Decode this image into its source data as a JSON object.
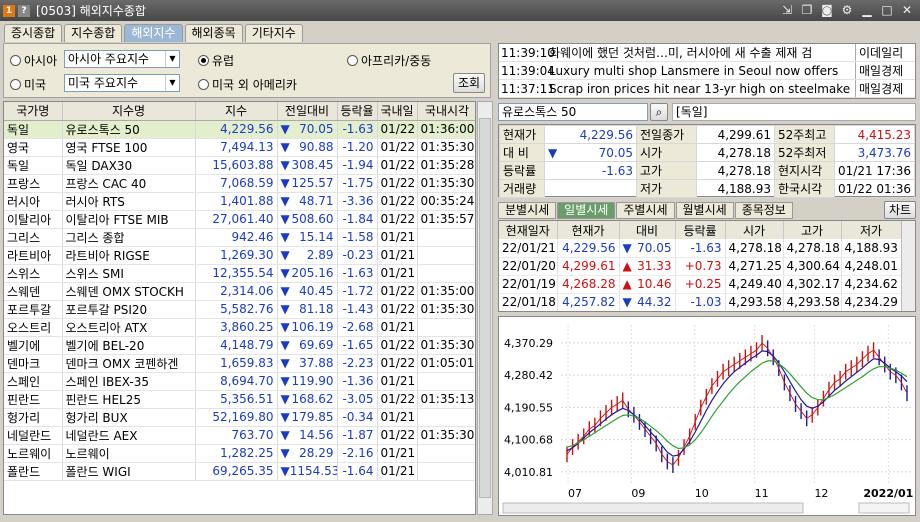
{
  "window": {
    "title": "[0503] 해외지수종합",
    "icon_num": "1",
    "icon_q": "?"
  },
  "tabs": [
    "증시종합",
    "지수종합",
    "해외지수",
    "해외종목",
    "기타지수"
  ],
  "filters": {
    "asia_label": "아시아",
    "asia_combo": "아시아 주요지수",
    "europe_label": "유럽",
    "africa_label": "아프리카/중동",
    "us_label": "미국",
    "us_combo": "미국 주요지수",
    "america_label": "미국 외 아메리카",
    "query_button": "조회"
  },
  "table": {
    "headers": [
      "국가명",
      "지수명",
      "지수",
      "전일대비",
      "등락율",
      "국내일",
      "국내시각"
    ],
    "rows": [
      {
        "country": "독일",
        "name": "유로스톡스 50",
        "index": "4,229.56",
        "arrow": "▼",
        "change": "70.05",
        "rate": "-1.63",
        "date": "01/22",
        "time": "01:36:00"
      },
      {
        "country": "영국",
        "name": "영국 FTSE 100",
        "index": "7,494.13",
        "arrow": "▼",
        "change": "90.88",
        "rate": "-1.20",
        "date": "01/22",
        "time": "01:35:30"
      },
      {
        "country": "독일",
        "name": "독일 DAX30",
        "index": "15,603.88",
        "arrow": "▼",
        "change": "308.45",
        "rate": "-1.94",
        "date": "01/22",
        "time": "01:35:28"
      },
      {
        "country": "프랑스",
        "name": "프랑스 CAC 40",
        "index": "7,068.59",
        "arrow": "▼",
        "change": "125.57",
        "rate": "-1.75",
        "date": "01/22",
        "time": "01:35:30"
      },
      {
        "country": "러시아",
        "name": "러시아 RTS",
        "index": "1,401.88",
        "arrow": "▼",
        "change": "48.71",
        "rate": "-3.36",
        "date": "01/22",
        "time": "00:35:24"
      },
      {
        "country": "이탈리아",
        "name": "이탈리아 FTSE MIB",
        "index": "27,061.40",
        "arrow": "▼",
        "change": "508.60",
        "rate": "-1.84",
        "date": "01/22",
        "time": "01:35:57"
      },
      {
        "country": "그리스",
        "name": "그리스 종합",
        "index": "942.46",
        "arrow": "▼",
        "change": "15.14",
        "rate": "-1.58",
        "date": "01/21",
        "time": ""
      },
      {
        "country": "라트비아",
        "name": "라트비아 RIGSE",
        "index": "1,269.30",
        "arrow": "▼",
        "change": "2.89",
        "rate": "-0.23",
        "date": "01/21",
        "time": ""
      },
      {
        "country": "스위스",
        "name": "스위스 SMI",
        "index": "12,355.54",
        "arrow": "▼",
        "change": "205.16",
        "rate": "-1.63",
        "date": "01/21",
        "time": ""
      },
      {
        "country": "스웨덴",
        "name": "스웨덴 OMX STOCKH",
        "index": "2,314.06",
        "arrow": "▼",
        "change": "40.45",
        "rate": "-1.72",
        "date": "01/22",
        "time": "01:35:00"
      },
      {
        "country": "포르투갈",
        "name": "포르투갈 PSI20",
        "index": "5,582.76",
        "arrow": "▼",
        "change": "81.18",
        "rate": "-1.43",
        "date": "01/22",
        "time": "01:35:30"
      },
      {
        "country": "오스트리",
        "name": "오스트리아 ATX",
        "index": "3,860.25",
        "arrow": "▼",
        "change": "106.19",
        "rate": "-2.68",
        "date": "01/21",
        "time": ""
      },
      {
        "country": "벨기에",
        "name": "벨기에 BEL-20",
        "index": "4,148.79",
        "arrow": "▼",
        "change": "69.69",
        "rate": "-1.65",
        "date": "01/22",
        "time": "01:35:30"
      },
      {
        "country": "덴마크",
        "name": "덴마크 OMX 코펜하겐",
        "index": "1,659.83",
        "arrow": "▼",
        "change": "37.88",
        "rate": "-2.23",
        "date": "01/22",
        "time": "01:05:01"
      },
      {
        "country": "스페인",
        "name": "스페인 IBEX-35",
        "index": "8,694.70",
        "arrow": "▼",
        "change": "119.90",
        "rate": "-1.36",
        "date": "01/21",
        "time": ""
      },
      {
        "country": "핀란드",
        "name": "핀란드 HEL25",
        "index": "5,356.51",
        "arrow": "▼",
        "change": "168.62",
        "rate": "-3.05",
        "date": "01/22",
        "time": "01:35:13"
      },
      {
        "country": "헝가리",
        "name": "헝가리 BUX",
        "index": "52,169.80",
        "arrow": "▼",
        "change": "179.85",
        "rate": "-0.34",
        "date": "01/21",
        "time": ""
      },
      {
        "country": "네덜란드",
        "name": "네덜란드 AEX",
        "index": "763.70",
        "arrow": "▼",
        "change": "14.56",
        "rate": "-1.87",
        "date": "01/22",
        "time": "01:35:30"
      },
      {
        "country": "노르웨이",
        "name": "노르웨이",
        "index": "1,282.25",
        "arrow": "▼",
        "change": "28.29",
        "rate": "-2.16",
        "date": "01/21",
        "time": ""
      },
      {
        "country": "폴란드",
        "name": "폴란드 WIGI",
        "index": "69,265.35",
        "arrow": "▼",
        "change": "1154.53",
        "rate": "-1.64",
        "date": "01/21",
        "time": ""
      }
    ]
  },
  "news": [
    {
      "time": "11:39:10",
      "headline": "화웨이에 했던 것처럼…미, 러시아에 새 수출 제재 검",
      "source": "이데일리"
    },
    {
      "time": "11:39:04",
      "headline": "Luxury multi shop Lansmere in Seoul now offers",
      "source": "매일경제"
    },
    {
      "time": "11:37:11",
      "headline": "Scrap iron prices hit near 13-yr high on steelmake",
      "source": "매일경제"
    }
  ],
  "selected": {
    "index_name": "유로스톡스 50",
    "country": "[독일]"
  },
  "quote": {
    "cur_label": "현재가",
    "cur": "4,229.56",
    "prev_label": "전일종가",
    "prev": "4,299.61",
    "hi52_label": "52주최고",
    "hi52": "4,415.23",
    "chg_label": "대 비",
    "chg_arrow": "▼",
    "chg": "70.05",
    "open_label": "시가",
    "open": "4,278.18",
    "lo52_label": "52주최저",
    "lo52": "3,473.76",
    "rate_label": "등락률",
    "rate": "-1.63",
    "high_label": "고가",
    "high": "4,278.18",
    "ltime_label": "현지시각",
    "ltime": "01/21 17:36",
    "vol_label": "거래량",
    "vol": "",
    "low_label": "저가",
    "low": "4,188.93",
    "ktime_label": "한국시각",
    "ktime": "01/22 01:36"
  },
  "subtabs": [
    "분별시세",
    "일별시세",
    "주별시세",
    "월별시세",
    "종목정보"
  ],
  "chart_button": "차트",
  "daily": {
    "headers": [
      "현재일자",
      "현재가",
      "대비",
      "등락률",
      "시가",
      "고가",
      "저가"
    ],
    "rows": [
      {
        "date": "22/01/21",
        "price": "4,229.56",
        "arrow": "▼",
        "chg": "70.05",
        "rate": "-1.63",
        "open": "4,278.18",
        "high": "4,278.18",
        "low": "4,188.93"
      },
      {
        "date": "22/01/20",
        "price": "4,299.61",
        "arrow": "▲",
        "chg": "31.33",
        "rate": "+0.73",
        "open": "4,271.25",
        "high": "4,300.64",
        "low": "4,248.01"
      },
      {
        "date": "22/01/19",
        "price": "4,268.28",
        "arrow": "▲",
        "chg": "10.46",
        "rate": "+0.25",
        "open": "4,249.40",
        "high": "4,302.17",
        "low": "4,234.62"
      },
      {
        "date": "22/01/18",
        "price": "4,257.82",
        "arrow": "▼",
        "chg": "44.32",
        "rate": "-1.03",
        "open": "4,293.58",
        "high": "4,293.58",
        "low": "4,234.29"
      }
    ]
  },
  "chart_data": {
    "type": "line",
    "y_ticks": [
      "4,370.29",
      "4,280.42",
      "4,190.55",
      "4,100.68",
      "4,010.81"
    ],
    "x_ticks": [
      "07",
      "09",
      "10",
      "11",
      "12",
      "2022/01"
    ],
    "ylim": [
      3980,
      4420
    ],
    "series": [
      {
        "color": "#d01010",
        "values": [
          4060,
          4080,
          4095,
          4110,
          4130,
          4140,
          4160,
          4175,
          4190,
          4200,
          4210,
          4185,
          4170,
          4150,
          4130,
          4110,
          4090,
          4060,
          4040,
          4030,
          4050,
          4080,
          4110,
          4150,
          4190,
          4220,
          4250,
          4270,
          4290,
          4300,
          4310,
          4320,
          4330,
          4340,
          4350,
          4370,
          4355,
          4330,
          4300,
          4260,
          4230,
          4200,
          4180,
          4160,
          4170,
          4190,
          4215,
          4240,
          4260,
          4270,
          4290,
          4300,
          4310,
          4325,
          4340,
          4350,
          4330,
          4310,
          4290,
          4280,
          4260,
          4230
        ]
      },
      {
        "color": "#1a1aa0",
        "values": [
          4070,
          4078,
          4090,
          4105,
          4120,
          4132,
          4145,
          4158,
          4170,
          4180,
          4188,
          4182,
          4170,
          4158,
          4140,
          4122,
          4105,
          4085,
          4066,
          4055,
          4058,
          4074,
          4095,
          4122,
          4152,
          4182,
          4210,
          4234,
          4256,
          4274,
          4290,
          4302,
          4314,
          4326,
          4336,
          4348,
          4346,
          4334,
          4314,
          4290,
          4262,
          4236,
          4212,
          4194,
          4188,
          4194,
          4206,
          4222,
          4238,
          4250,
          4264,
          4276,
          4288,
          4300,
          4314,
          4326,
          4324,
          4314,
          4300,
          4290,
          4278,
          4262
        ]
      },
      {
        "color": "#2fa02f",
        "values": [
          4080,
          4084,
          4092,
          4100,
          4110,
          4120,
          4130,
          4140,
          4150,
          4160,
          4168,
          4170,
          4166,
          4160,
          4150,
          4138,
          4126,
          4112,
          4096,
          4084,
          4076,
          4078,
          4086,
          4100,
          4120,
          4142,
          4166,
          4188,
          4208,
          4228,
          4246,
          4262,
          4276,
          4290,
          4302,
          4314,
          4320,
          4320,
          4312,
          4300,
          4284,
          4266,
          4248,
          4230,
          4218,
          4212,
          4212,
          4218,
          4226,
          4236,
          4246,
          4256,
          4266,
          4276,
          4288,
          4298,
          4304,
          4304,
          4300,
          4294,
          4286,
          4276
        ]
      }
    ]
  }
}
